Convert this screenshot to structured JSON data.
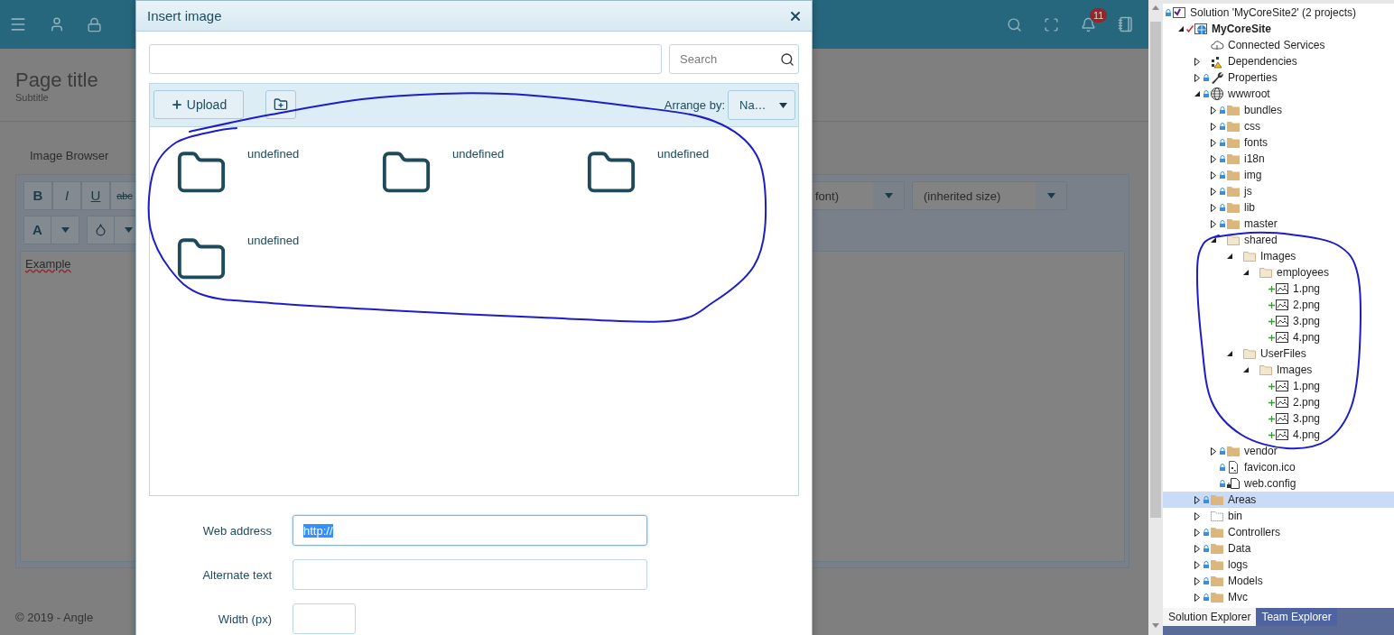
{
  "top_bar": {
    "notification_count": "11"
  },
  "page_header": {
    "title": "Page title",
    "subtitle": "Subtitle"
  },
  "section_title": "Image Browser",
  "editor": {
    "format_buttons": [
      {
        "label": "B",
        "kind": "bold"
      },
      {
        "label": "I",
        "kind": "italic"
      },
      {
        "label": "U",
        "kind": "underline"
      },
      {
        "label": "abc",
        "kind": "strike"
      }
    ],
    "font_select": "font)",
    "size_select": "(inherited size)",
    "color_button": "A",
    "content": "Example"
  },
  "footer": "© 2019 - Angle",
  "dialog": {
    "title": "Insert image",
    "search": {
      "placeholder": "Search"
    },
    "upload_button": "Upload",
    "arrange_label": "Arrange by:",
    "arrange_value": "Na…",
    "items": [
      {
        "label": "undefined",
        "kind": "folder"
      },
      {
        "label": "undefined",
        "kind": "folder"
      },
      {
        "label": "undefined",
        "kind": "folder"
      },
      {
        "label": "undefined",
        "kind": "folder"
      }
    ],
    "form": [
      {
        "label": "Web address",
        "kind": "text",
        "value": "http://",
        "highlighted": true
      },
      {
        "label": "Alternate text",
        "kind": "text"
      },
      {
        "label": "Width (px)",
        "kind": "number"
      }
    ]
  },
  "solution_explorer": {
    "tree": [
      {
        "label": "Solution 'MyCoreSite2' (2 projects)",
        "kind": "solution",
        "locked": true,
        "selected": false,
        "children": [
          {
            "label": "MyCoreSite",
            "kind": "web-project",
            "checked": true,
            "startup": true,
            "expanded": true,
            "selected": false,
            "children": [
              {
                "label": "Connected Services",
                "kind": "cloud",
                "selected": false
              },
              {
                "label": "Dependencies",
                "kind": "dependencies",
                "expanded": false,
                "selected": false
              },
              {
                "label": "Properties",
                "kind": "wrench",
                "locked": true,
                "expanded": false,
                "selected": false
              },
              {
                "label": "wwwroot",
                "kind": "globe",
                "locked": true,
                "expanded": true,
                "selected": false,
                "children": [
                  {
                    "label": "bundles",
                    "kind": "folder",
                    "locked": true,
                    "expanded": false,
                    "selected": false
                  },
                  {
                    "label": "css",
                    "kind": "folder",
                    "locked": true,
                    "expanded": false,
                    "selected": false
                  },
                  {
                    "label": "fonts",
                    "kind": "folder",
                    "locked": true,
                    "expanded": false,
                    "selected": false
                  },
                  {
                    "label": "i18n",
                    "kind": "folder",
                    "locked": true,
                    "expanded": false,
                    "selected": false
                  },
                  {
                    "label": "img",
                    "kind": "folder",
                    "locked": true,
                    "expanded": false,
                    "selected": false
                  },
                  {
                    "label": "js",
                    "kind": "folder",
                    "locked": true,
                    "expanded": false,
                    "selected": false
                  },
                  {
                    "label": "lib",
                    "kind": "folder",
                    "locked": true,
                    "expanded": false,
                    "selected": false
                  },
                  {
                    "label": "master",
                    "kind": "folder",
                    "locked": true,
                    "expanded": false,
                    "selected": false
                  },
                  {
                    "label": "shared",
                    "kind": "folder-outline",
                    "expanded": true,
                    "selected": false,
                    "children": [
                      {
                        "label": "Images",
                        "kind": "folder-outline",
                        "expanded": true,
                        "selected": false,
                        "children": [
                          {
                            "label": "employees",
                            "kind": "folder-outline",
                            "expanded": true,
                            "selected": false,
                            "children": [
                              {
                                "label": "1.png",
                                "kind": "image",
                                "added": true,
                                "selected": false
                              },
                              {
                                "label": "2.png",
                                "kind": "image",
                                "added": true,
                                "selected": false
                              },
                              {
                                "label": "3.png",
                                "kind": "image",
                                "added": true,
                                "selected": false
                              },
                              {
                                "label": "4.png",
                                "kind": "image",
                                "added": true,
                                "selected": false
                              }
                            ]
                          }
                        ]
                      },
                      {
                        "label": "UserFiles",
                        "kind": "folder-outline",
                        "expanded": true,
                        "selected": false,
                        "children": [
                          {
                            "label": "Images",
                            "kind": "folder-outline",
                            "expanded": true,
                            "selected": false,
                            "children": [
                              {
                                "label": "1.png",
                                "kind": "image",
                                "added": true,
                                "selected": false
                              },
                              {
                                "label": "2.png",
                                "kind": "image",
                                "added": true,
                                "selected": false
                              },
                              {
                                "label": "3.png",
                                "kind": "image",
                                "added": true,
                                "selected": false
                              },
                              {
                                "label": "4.png",
                                "kind": "image",
                                "added": true,
                                "selected": false
                              }
                            ]
                          }
                        ]
                      }
                    ]
                  },
                  {
                    "label": "vendor",
                    "kind": "folder",
                    "locked": true,
                    "expanded": false,
                    "selected": false
                  },
                  {
                    "label": "favicon.ico",
                    "kind": "icon-file",
                    "locked": true,
                    "selected": false
                  },
                  {
                    "label": "web.config",
                    "kind": "config",
                    "locked": true,
                    "selected": false
                  }
                ]
              },
              {
                "label": "Areas",
                "kind": "folder",
                "locked": true,
                "expanded": false,
                "selected": true
              },
              {
                "label": "bin",
                "kind": "excluded-folder",
                "expanded": false,
                "selected": false
              },
              {
                "label": "Controllers",
                "kind": "folder",
                "locked": true,
                "expanded": false,
                "selected": false
              },
              {
                "label": "Data",
                "kind": "folder",
                "locked": true,
                "expanded": false,
                "selected": false
              },
              {
                "label": "logs",
                "kind": "folder",
                "locked": true,
                "expanded": false,
                "selected": false
              },
              {
                "label": "Models",
                "kind": "folder",
                "locked": true,
                "expanded": false,
                "selected": false
              },
              {
                "label": "Mvc",
                "kind": "folder",
                "locked": true,
                "expanded": false,
                "selected": false
              }
            ]
          }
        ]
      }
    ],
    "tabs": [
      {
        "label": "Solution Explorer",
        "selected": true
      },
      {
        "label": "Team Explorer",
        "selected": false
      }
    ]
  }
}
